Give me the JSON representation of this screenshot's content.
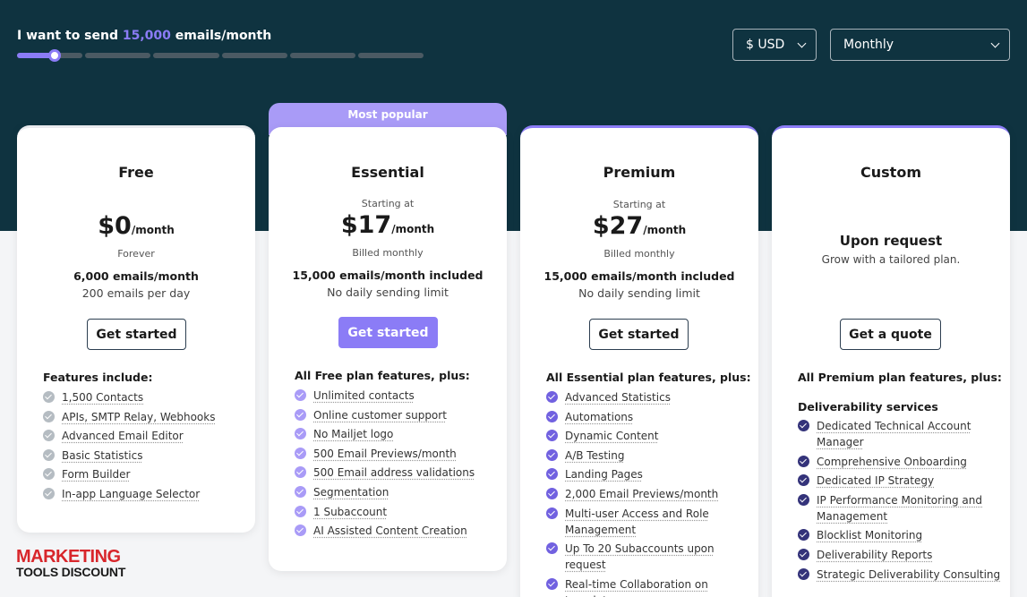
{
  "slider": {
    "label_prefix": "I want to send",
    "value_label": "15,000",
    "label_suffix": "emails/month",
    "segments": 6,
    "fill_fraction": 0.093
  },
  "currency_select": {
    "value": "$ USD"
  },
  "period_select": {
    "value": "Monthly"
  },
  "colors": {
    "header_bg": "#0f3340",
    "accent": "#8b7cf6",
    "popular_tab": "#a99bf7"
  },
  "plans": {
    "free": {
      "name": "Free",
      "price": "$0",
      "per": "/month",
      "price_note": "Forever",
      "volume": "6,000 emails/month",
      "volume_sub": "200 emails per day",
      "cta": "Get started",
      "features_head": "Features include:",
      "features": [
        "1,500 Contacts",
        "APIs, SMTP Relay, Webhooks",
        "Advanced Email Editor",
        "Basic Statistics",
        "Form Builder",
        "In-app Language Selector"
      ]
    },
    "essential": {
      "badge": "Most popular",
      "name": "Essential",
      "starting": "Starting at",
      "price": "$17",
      "per": "/month",
      "price_note": "Billed monthly",
      "volume": "15,000 emails/month included",
      "volume_sub": "No daily sending limit",
      "cta": "Get started",
      "features_head": "All Free plan features, plus:",
      "features": [
        "Unlimited contacts",
        "Online customer support",
        "No Mailjet logo",
        "500 Email Previews/month",
        "500 Email address validations",
        "Segmentation",
        "1 Subaccount",
        "AI Assisted Content Creation"
      ]
    },
    "premium": {
      "name": "Premium",
      "starting": "Starting at",
      "price": "$27",
      "per": "/month",
      "price_note": "Billed monthly",
      "volume": "15,000 emails/month included",
      "volume_sub": "No daily sending limit",
      "cta": "Get started",
      "features_head": "All Essential plan features, plus:",
      "features": [
        "Advanced Statistics",
        "Automations",
        "Dynamic Content",
        "A/B Testing",
        "Landing Pages",
        "2,000 Email Previews/month",
        "Multi-user Access and Role Management",
        "Up To 20 Subaccounts upon request",
        "Real-time Collaboration on templates"
      ]
    },
    "custom": {
      "name": "Custom",
      "title": "Upon request",
      "subtitle": "Grow with a tailored plan.",
      "cta": "Get a quote",
      "features_head": "All Premium plan features, plus:",
      "subhead": "Deliverability services",
      "features": [
        "Dedicated Technical Account Manager",
        "Comprehensive Onboarding",
        "Dedicated IP Strategy",
        "IP Performance Monitoring and Management",
        "Blocklist Monitoring",
        "Deliverability Reports",
        "Strategic Deliverability Consulting"
      ]
    }
  },
  "watermark": {
    "line1": "MARKETING",
    "line2": "TOOLS DISCOUNT"
  }
}
